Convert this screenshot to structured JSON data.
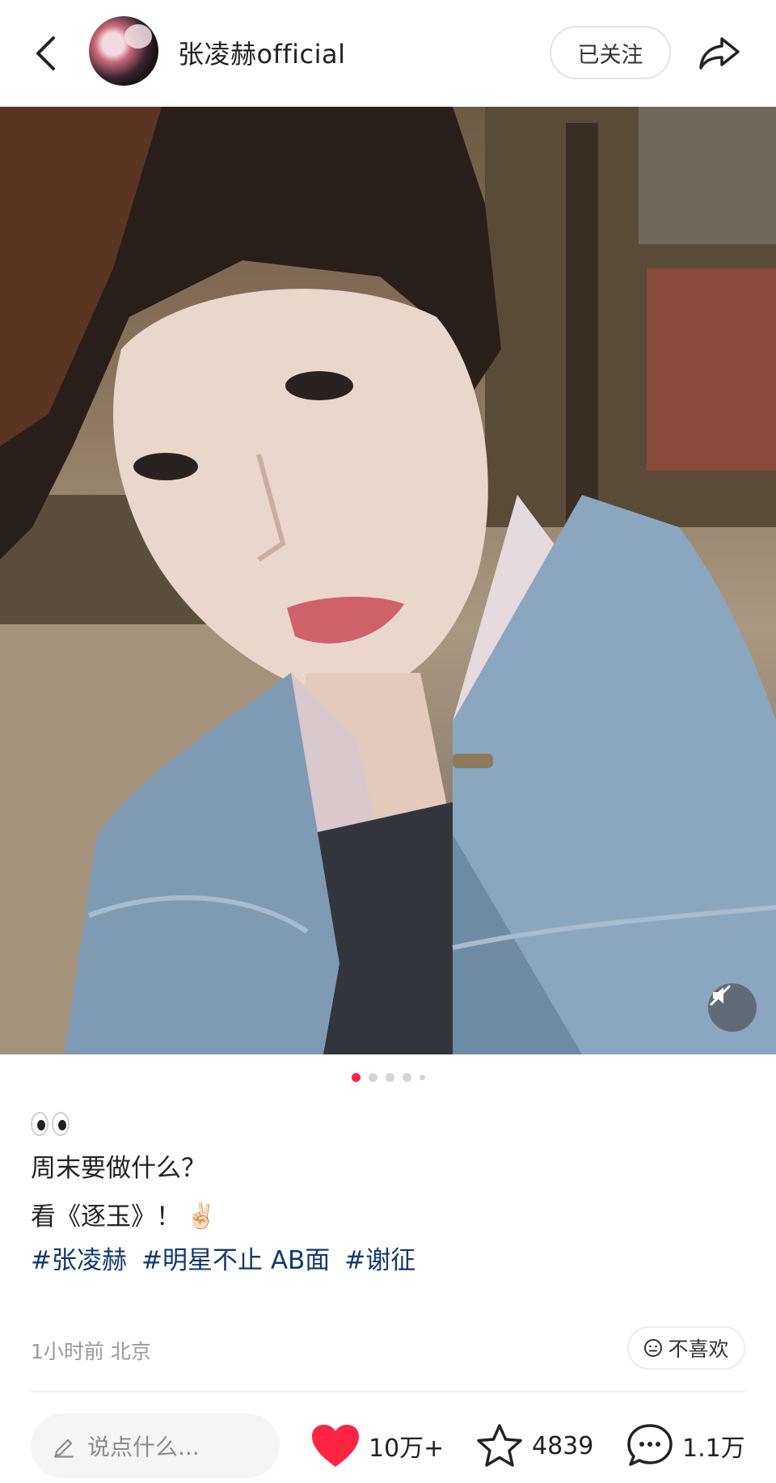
{
  "header": {
    "back_icon": "chevron-left-icon",
    "account_name": "张凌赫official",
    "follow_label": "已关注",
    "share_icon": "share-arrow-icon"
  },
  "post": {
    "carousel": {
      "total": 5,
      "active_index": 0
    },
    "mute_icon": "speaker-muted-icon",
    "caption": {
      "emoji": "👀",
      "line1": "周末要做什么？",
      "line2": "看《逐玉》！",
      "line2_emoji": "✌🏻",
      "hashtags": [
        "#张凌赫",
        "#明星不止 AB面",
        "#谢征"
      ]
    },
    "meta": "1小时前 北京",
    "dislike_label": "不喜欢"
  },
  "bottom_bar": {
    "comment_placeholder": "说点什么...",
    "likes": "10万+",
    "favorites": "4839",
    "comments": "1.1万"
  },
  "colors": {
    "accent": "#ff2442",
    "hashtag": "#13386c",
    "meta_text": "#9a9a9a"
  }
}
